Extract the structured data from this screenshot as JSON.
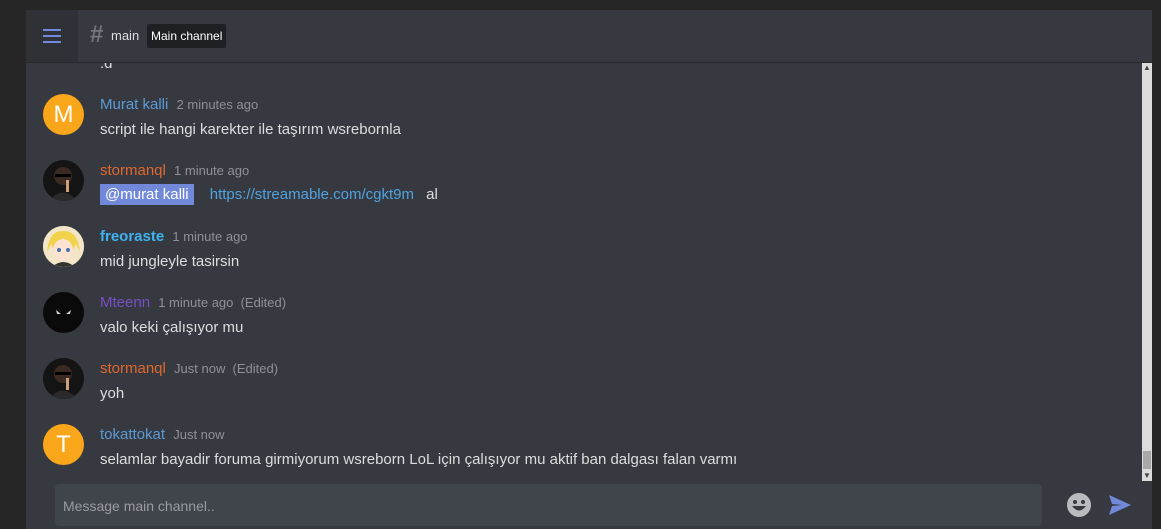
{
  "header": {
    "channel_name": "main",
    "channel_description": "Main channel"
  },
  "messages": [
    {
      "author": "Murat kalli",
      "author_color": "#5b9bd5",
      "time": "2 minutes ago",
      "edited": "",
      "body": "script ile hangi karekter ile taşırım wsrebornla",
      "avatar_letter": "M"
    },
    {
      "author": "stormanql",
      "author_color": "#e0682f",
      "time": "1 minute ago",
      "edited": "",
      "mention": "@murat kalli",
      "link": "https://streamable.com/cgkt9m",
      "trailing": "al"
    },
    {
      "author": "freoraste",
      "author_color": "#3eb3f0",
      "time": "1 minute ago",
      "edited": "",
      "body": "mid jungleyle tasirsin"
    },
    {
      "author": "Mteenn",
      "author_color": "#7b4fc4",
      "time": "1 minute ago",
      "edited": "(Edited)",
      "body": "valo keki çalışıyor mu"
    },
    {
      "author": "stormanql",
      "author_color": "#e0682f",
      "time": "Just now",
      "edited": "(Edited)",
      "body": "yoh"
    },
    {
      "author": "tokattokat",
      "author_color": "#5b9bd5",
      "time": "Just now",
      "edited": "",
      "body": "selamlar bayadir foruma girmiyorum wsreborn LoL için çalışıyor mu aktif ban dalgası falan varmı",
      "avatar_letter": "T"
    }
  ],
  "fragment_text": ".d",
  "composer": {
    "placeholder": "Message main channel.."
  },
  "icons": {
    "menu": "hamburger-icon",
    "hash": "hash-icon",
    "emoji": "emoji-icon",
    "send": "send-icon"
  },
  "colors": {
    "accent": "#7289da",
    "background": "#36393f",
    "mention_bg": "#7289da"
  }
}
